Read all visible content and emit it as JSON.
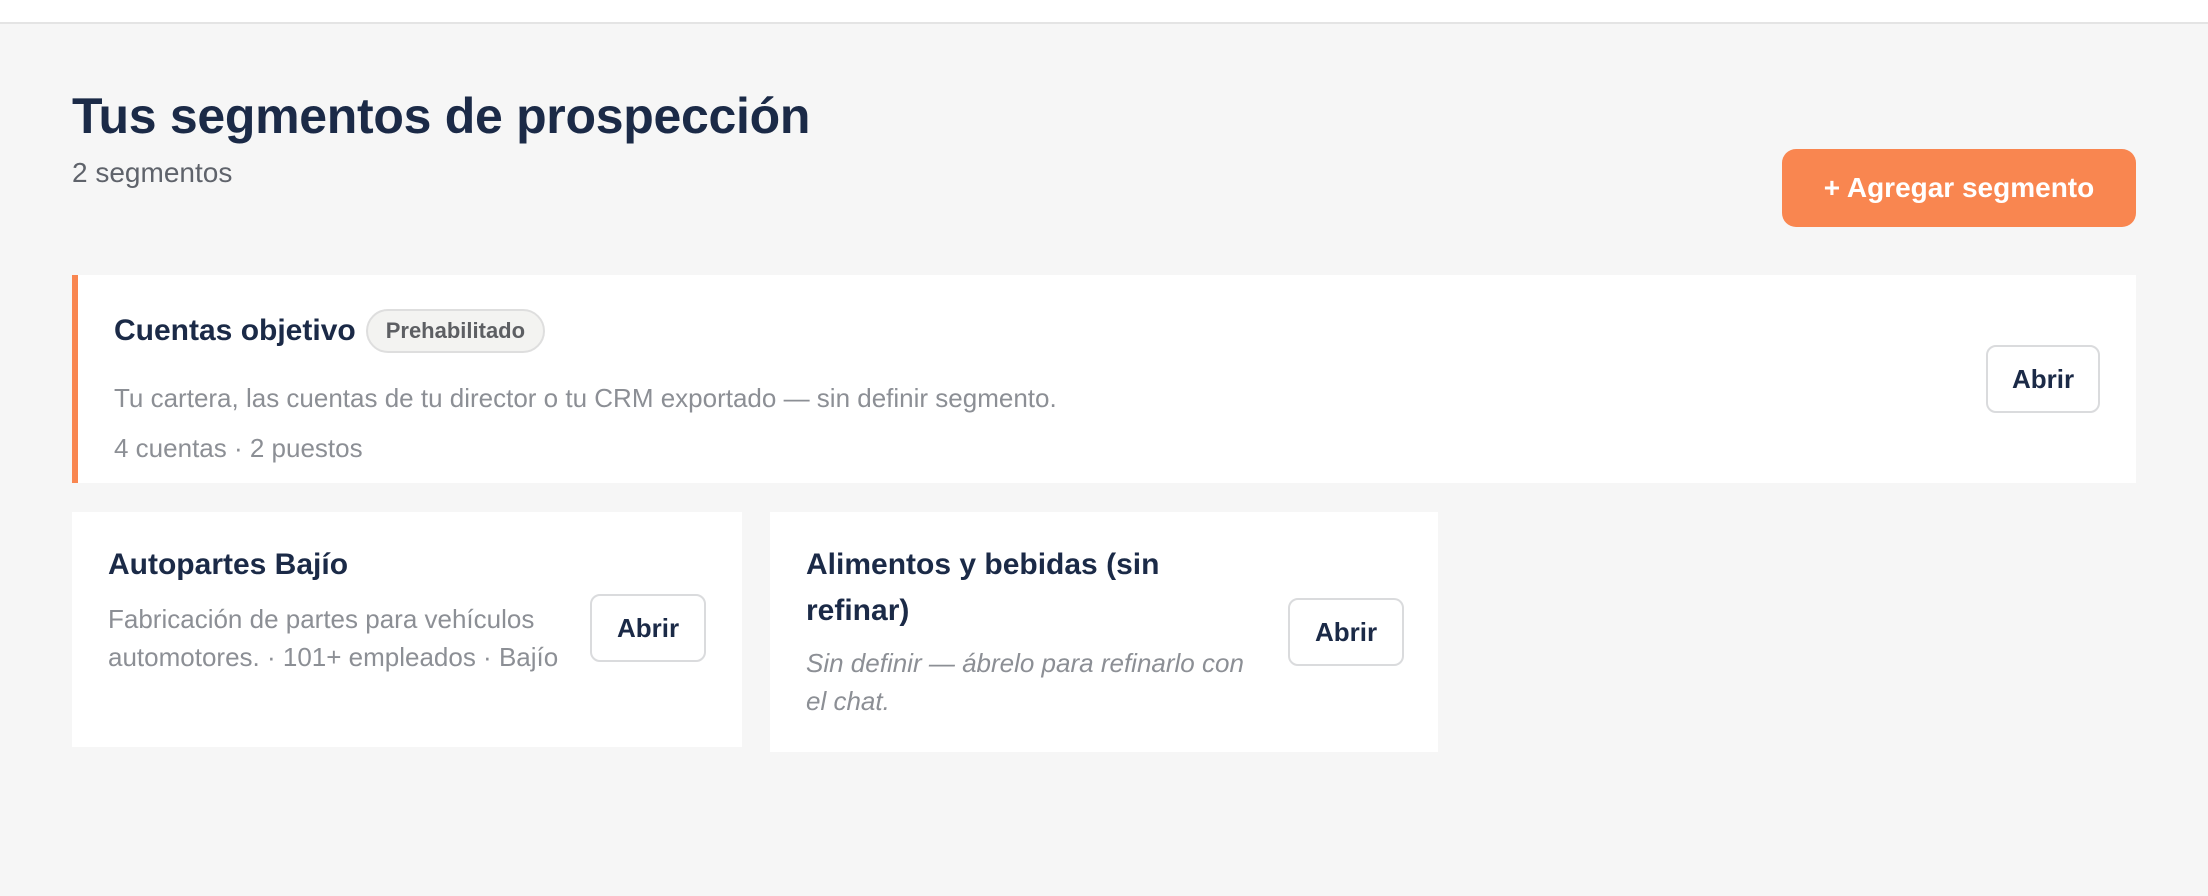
{
  "header": {
    "title": "Tus segmentos de prospección",
    "count": "2 segmentos",
    "add_button": "+ Agregar segmento"
  },
  "segments": [
    {
      "title": "Cuentas objetivo",
      "badge": "Prehabilitado",
      "description": "Tu cartera, las cuentas de tu director o tu CRM exportado — sin definir segmento.",
      "meta": "4 cuentas · 2 puestos",
      "open_label": "Abrir"
    },
    {
      "title": "Autopartes Bajío",
      "description": "Fabricación de partes para vehículos automotores. · 101+ empleados · Bajío",
      "open_label": "Abrir"
    },
    {
      "title": "Alimentos y bebidas (sin refinar)",
      "description": "Sin definir — ábrelo para refinarlo con el chat.",
      "open_label": "Abrir"
    }
  ],
  "colors": {
    "accent": "#f98650",
    "title": "#1b2a47",
    "muted": "#8c8f95",
    "background": "#f6f6f6"
  }
}
